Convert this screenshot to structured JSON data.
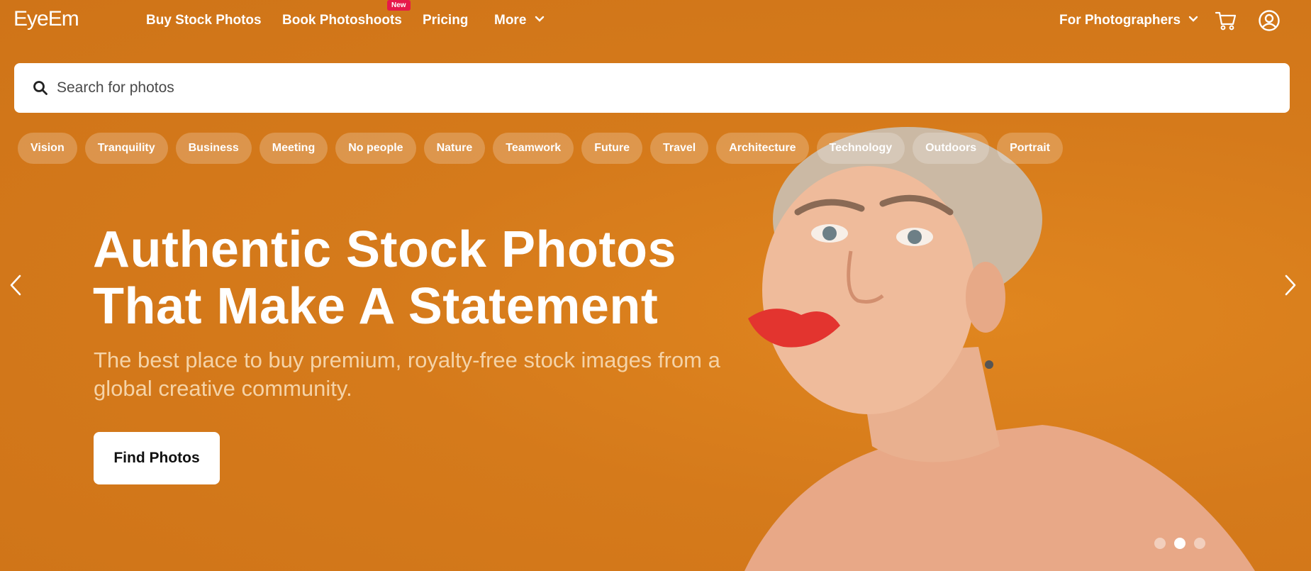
{
  "brand": {
    "logo": "EyeEm",
    "accent": "#d87d1d",
    "badge_color": "#e6194b"
  },
  "nav": {
    "buy": "Buy Stock Photos",
    "book": "Book Photoshoots",
    "new_badge": "New",
    "pricing": "Pricing",
    "more": "More",
    "photographers": "For Photographers",
    "icons": [
      "chevron-down-icon",
      "cart-icon",
      "account-icon"
    ]
  },
  "search": {
    "placeholder": "Search for photos",
    "value": ""
  },
  "chips": [
    "Vision",
    "Tranquility",
    "Business",
    "Meeting",
    "No people",
    "Nature",
    "Teamwork",
    "Future",
    "Travel",
    "Architecture",
    "Technology",
    "Outdoors",
    "Portrait"
  ],
  "hero": {
    "title_line1": "Authentic Stock Photos",
    "title_line2": "That Make A Statement",
    "subtitle": "The best place to buy premium, royalty-free stock images from a global creative community.",
    "cta": "Find Photos"
  },
  "carousel": {
    "slides": 3,
    "active_index": 1
  }
}
